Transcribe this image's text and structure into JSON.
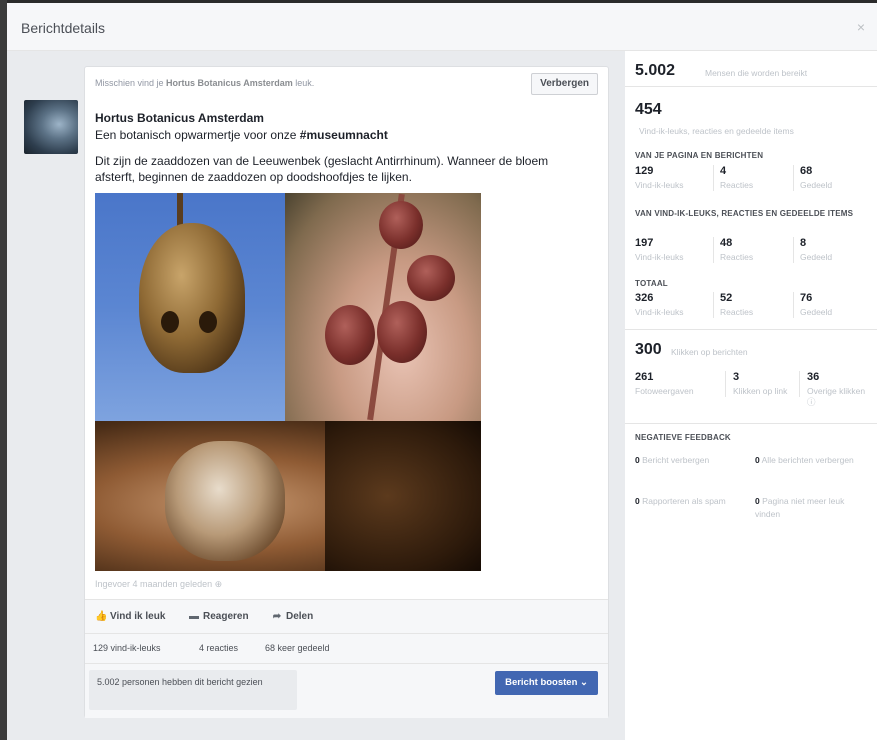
{
  "dialog": {
    "title": "Berichtdetails",
    "close": "×"
  },
  "card": {
    "suggestion_prefix": "Misschien vind je",
    "suggestion_page": "Hortus Botanicus Amsterdam",
    "suggestion_suffix": "leuk.",
    "hide_button": "Verbergen",
    "page_name": "Hortus Botanicus Amsterdam",
    "intro_text": "Een botanisch opwarmertje voor onze",
    "hashtag": "#museumnacht",
    "body": "Dit zijn de zaaddozen van de Leeuwenbek (geslacht Antirrhinum). Wanneer de bloem afsterft, beginnen de zaaddozen op doodshoofdjes te lijken.",
    "posted_info": "Ingevoer 4 maanden geleden ⊕"
  },
  "actions": {
    "like": "Vind ik leuk",
    "comment": "Reageren",
    "share": "Delen",
    "like_icon": "thumbs-up-icon",
    "comment_icon": "speech-bubble-icon",
    "share_icon": "share-arrow-icon"
  },
  "stats": {
    "likes": "129 vind-ik-leuks",
    "comments": "4 reacties",
    "shares": "68 keer gedeeld"
  },
  "footer": {
    "seen_text": "5.002 personen hebben dit bericht gezien",
    "boost_button": "Bericht boosten ⌄"
  },
  "panel": {
    "reach_number": "5.002",
    "reach_label": "Mensen die worden bereikt",
    "engagement_number": "454",
    "engagement_label": "Vind-ik-leuks, reacties en gedeelde items",
    "section_page": {
      "title": "VAN JE PAGINA EN BERICHTEN",
      "cols": [
        {
          "num": "129",
          "label": "Vind-ik-leuks"
        },
        {
          "num": "4",
          "label": "Reacties"
        },
        {
          "num": "68",
          "label": "Gedeeld"
        }
      ]
    },
    "section_shares": {
      "title": "VAN VIND-IK-LEUKS, REACTIES EN GEDEELDE ITEMS",
      "cols": [
        {
          "num": "197",
          "label": "Vind-ik-leuks"
        },
        {
          "num": "48",
          "label": "Reacties"
        },
        {
          "num": "8",
          "label": "Gedeeld"
        }
      ]
    },
    "section_total": {
      "title": "TOTAAL",
      "cols": [
        {
          "num": "326",
          "label": "Vind-ik-leuks"
        },
        {
          "num": "52",
          "label": "Reacties"
        },
        {
          "num": "76",
          "label": "Gedeeld"
        }
      ]
    },
    "clicks_number": "300",
    "clicks_label": "Klikken op berichten",
    "clicks_cols": [
      {
        "num": "261",
        "label": "Fotoweergaven"
      },
      {
        "num": "3",
        "label": "Klikken op link"
      },
      {
        "num": "36",
        "label": "Overige klikken ⓘ"
      }
    ],
    "negative": {
      "title": "NEGATIEVE FEEDBACK",
      "items": [
        {
          "num": "0",
          "label": "Bericht verbergen"
        },
        {
          "num": "0",
          "label": "Alle berichten verbergen"
        },
        {
          "num": "0",
          "label": "Rapporteren als spam"
        },
        {
          "num": "0",
          "label": "Pagina niet meer leuk vinden"
        }
      ]
    }
  }
}
